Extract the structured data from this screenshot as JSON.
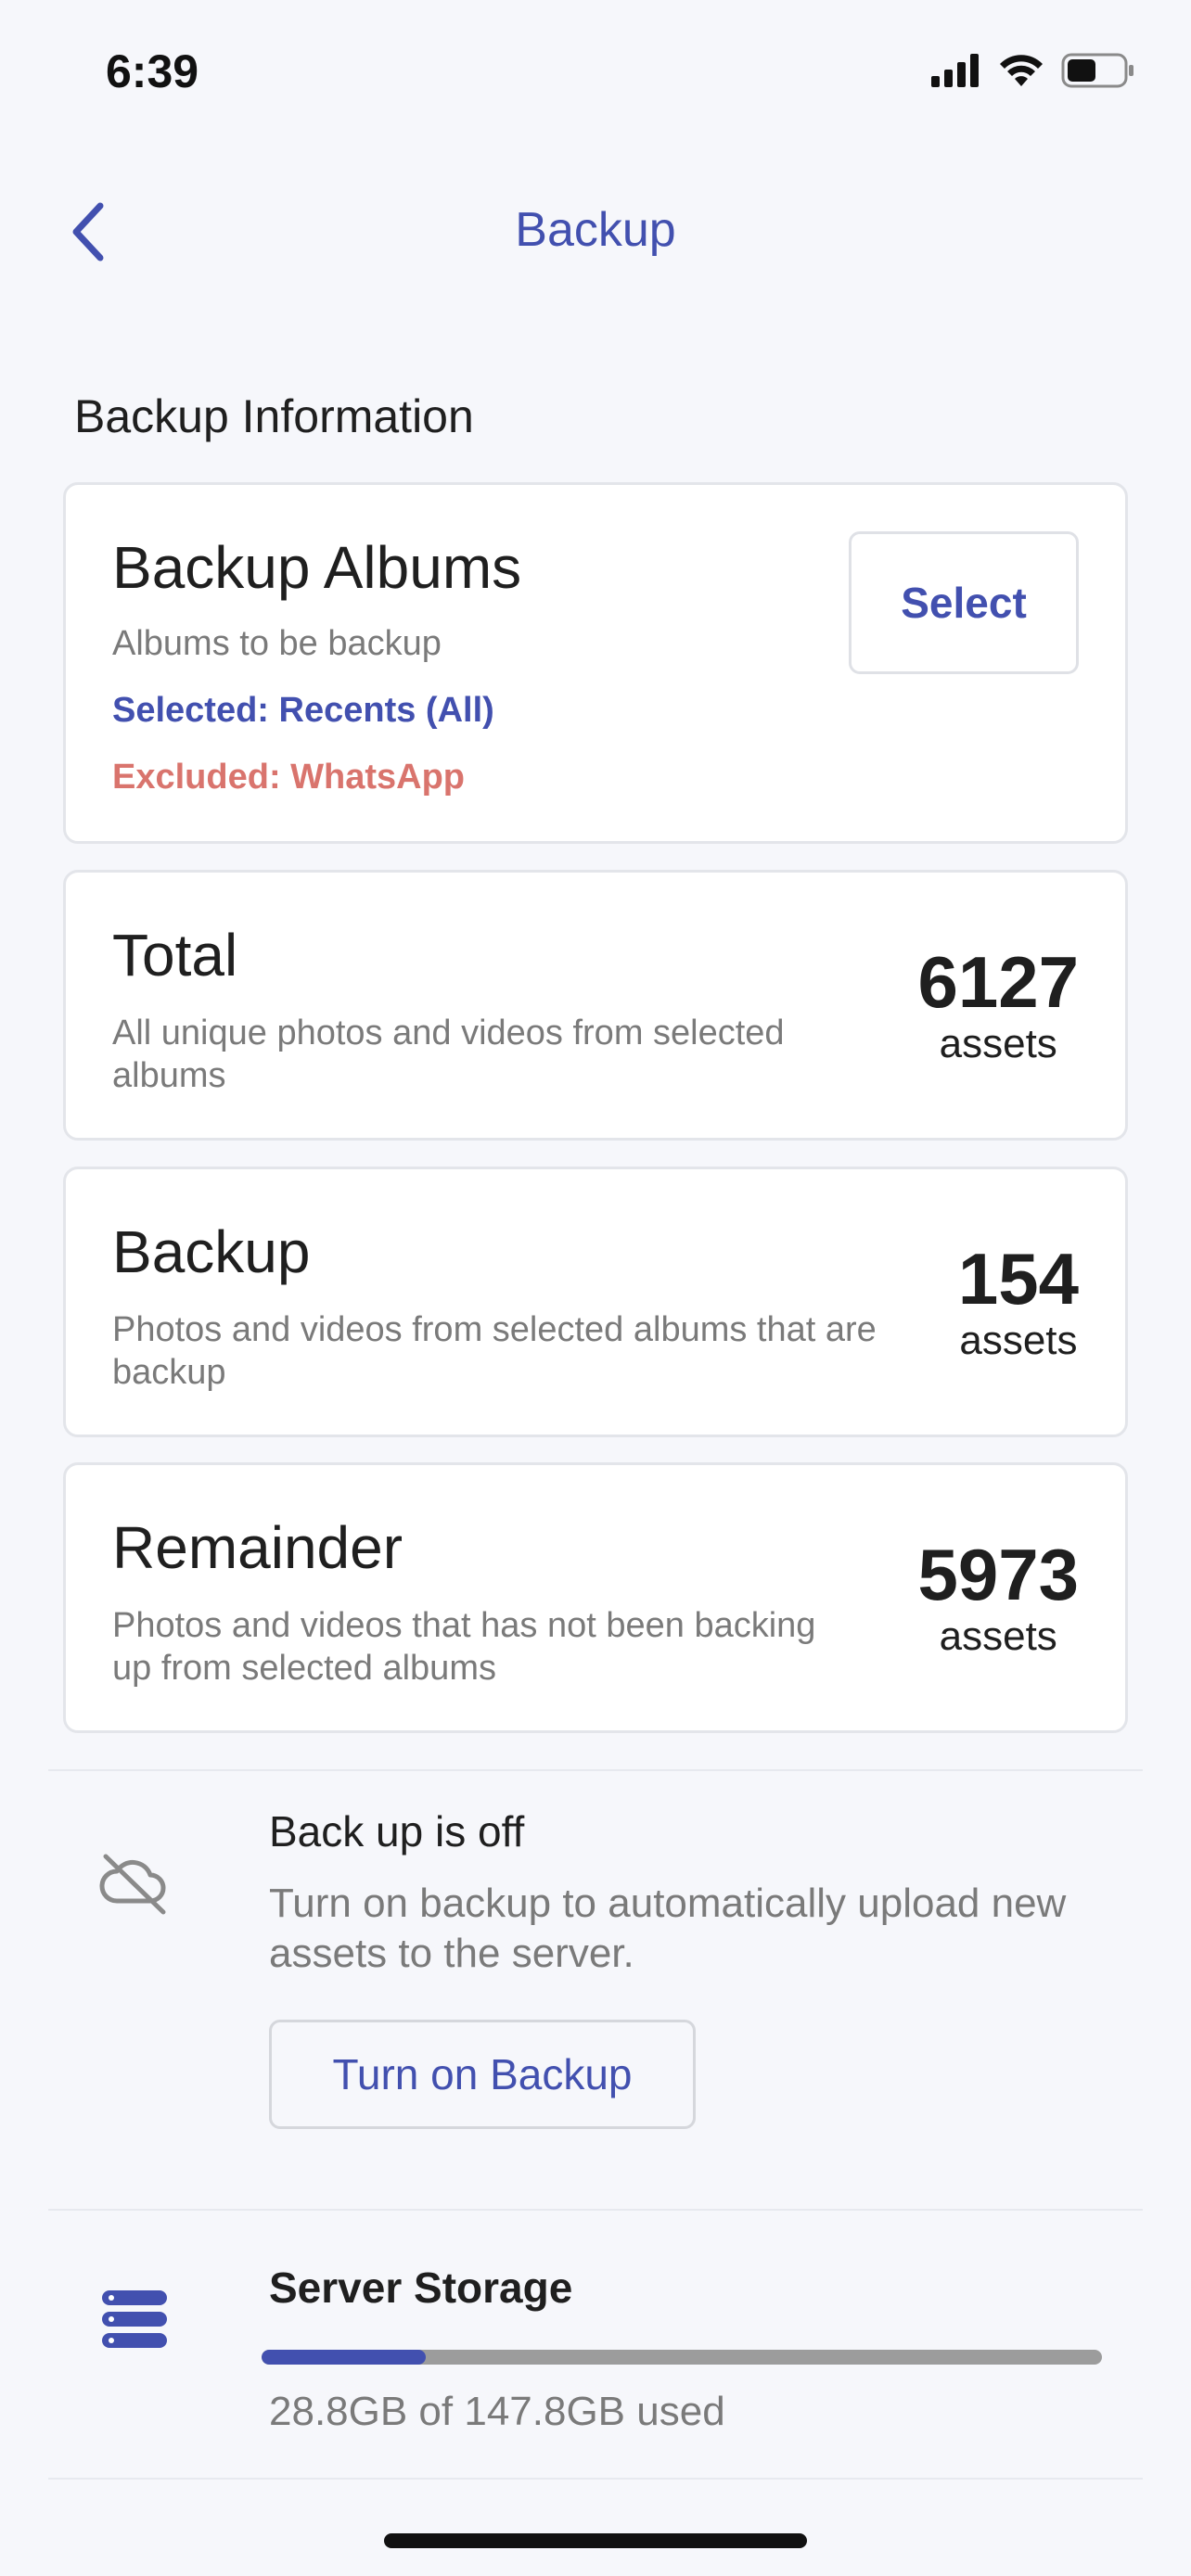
{
  "status_bar": {
    "time": "6:39"
  },
  "header": {
    "title": "Backup",
    "back_icon": "chevron-left-icon"
  },
  "section": {
    "title": "Backup Information"
  },
  "albums_card": {
    "title": "Backup Albums",
    "subtitle": "Albums to be backup",
    "selected": "Selected: Recents (All)",
    "excluded": "Excluded: WhatsApp",
    "select_label": "Select"
  },
  "total_card": {
    "title": "Total",
    "description": "All unique photos and videos from selected albums",
    "count": "6127",
    "unit": "assets"
  },
  "backup_card": {
    "title": "Backup",
    "description": "Photos and videos from selected albums that are backup",
    "count": "154",
    "unit": "assets"
  },
  "remainder_card": {
    "title": "Remainder",
    "description": "Photos and videos that has not been backing up from selected albums",
    "count": "5973",
    "unit": "assets"
  },
  "backup_status": {
    "icon": "cloud-off-icon",
    "title": "Back up is off",
    "description": "Turn on backup to automatically upload new assets to the server.",
    "button_label": "Turn on Backup"
  },
  "server_storage": {
    "icon": "server-icon",
    "title": "Server Storage",
    "used_fraction": 0.195,
    "usage_text": "28.8GB of 147.8GB used"
  },
  "colors": {
    "accent": "#4250af",
    "excluded": "#d9746d",
    "background": "#f6f7fb"
  }
}
